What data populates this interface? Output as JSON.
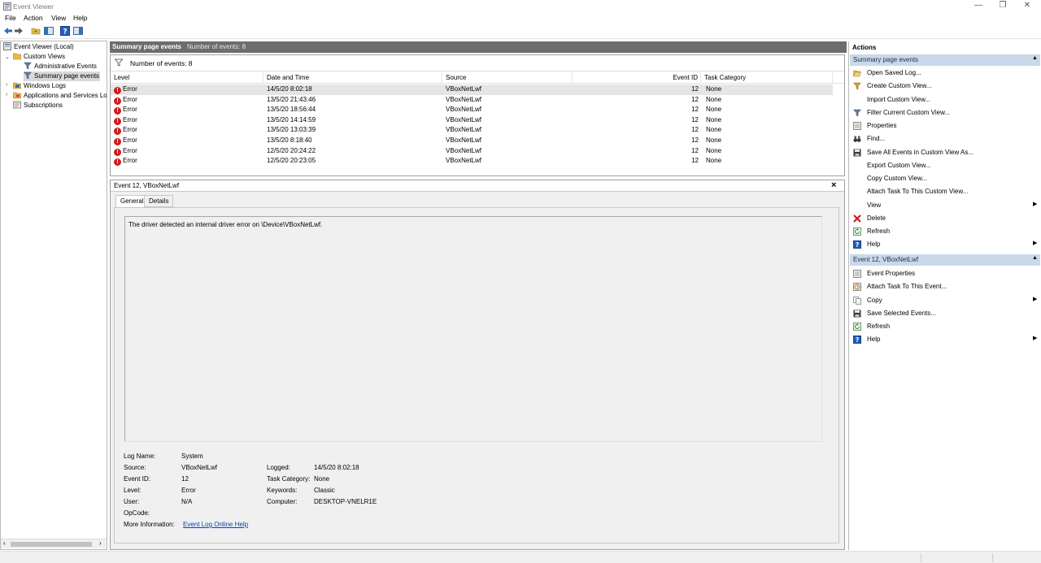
{
  "window": {
    "title": "Event Viewer"
  },
  "menu": [
    "File",
    "Action",
    "View",
    "Help"
  ],
  "tree": {
    "root": "Event Viewer (Local)",
    "custom_views": "Custom Views",
    "administrative_events": "Administrative Events",
    "summary_page_events": "Summary page events",
    "windows_logs": "Windows Logs",
    "apps_services": "Applications and Services Lo",
    "subscriptions": "Subscriptions"
  },
  "center": {
    "header_title": "Summary page events",
    "header_count": "Number of events: 8",
    "filter_text": "Number of events: 8",
    "columns": [
      "Level",
      "Date and Time",
      "Source",
      "Event ID",
      "Task Category"
    ],
    "rows": [
      {
        "level": "Error",
        "datetime": "14/5/20 8:02:18",
        "source": "VBoxNetLwf",
        "event_id": "12",
        "category": "None"
      },
      {
        "level": "Error",
        "datetime": "13/5/20 21:43:46",
        "source": "VBoxNetLwf",
        "event_id": "12",
        "category": "None"
      },
      {
        "level": "Error",
        "datetime": "13/5/20 18:56:44",
        "source": "VBoxNetLwf",
        "event_id": "12",
        "category": "None"
      },
      {
        "level": "Error",
        "datetime": "13/5/20 14:14:59",
        "source": "VBoxNetLwf",
        "event_id": "12",
        "category": "None"
      },
      {
        "level": "Error",
        "datetime": "13/5/20 13:03:39",
        "source": "VBoxNetLwf",
        "event_id": "12",
        "category": "None"
      },
      {
        "level": "Error",
        "datetime": "13/5/20 8:18:40",
        "source": "VBoxNetLwf",
        "event_id": "12",
        "category": "None"
      },
      {
        "level": "Error",
        "datetime": "12/5/20 20:24:22",
        "source": "VBoxNetLwf",
        "event_id": "12",
        "category": "None"
      },
      {
        "level": "Error",
        "datetime": "12/5/20 20:23:05",
        "source": "VBoxNetLwf",
        "event_id": "12",
        "category": "None"
      }
    ]
  },
  "detail": {
    "title": "Event 12, VBoxNetLwf",
    "tabs": [
      "General",
      "Details"
    ],
    "description": "The driver detected an internal driver error on \\Device\\VBoxNetLwf.",
    "labels": {
      "log_name": "Log Name:",
      "source": "Source:",
      "event_id": "Event ID:",
      "level": "Level:",
      "user": "User:",
      "opcode": "OpCode:",
      "more_info": "More Information:",
      "logged": "Logged:",
      "task_category": "Task Category:",
      "keywords": "Keywords:",
      "computer": "Computer:"
    },
    "values": {
      "log_name": "System",
      "source": "VBoxNetLwf",
      "event_id": "12",
      "level": "Error",
      "user": "N/A",
      "opcode": "",
      "more_info": "Event Log Online Help",
      "logged": "14/5/20 8:02:18",
      "task_category": "None",
      "keywords": "Classic",
      "computer": "DESKTOP-VNELR1E"
    }
  },
  "actions": {
    "title": "Actions",
    "section1": "Summary page events",
    "items1": [
      {
        "label": "Open Saved Log...",
        "icon": "folder-open-icon"
      },
      {
        "label": "Create Custom View...",
        "icon": "filter-create-icon"
      },
      {
        "label": "Import Custom View...",
        "icon": ""
      },
      {
        "label": "Filter Current Custom View...",
        "icon": "filter-icon"
      },
      {
        "label": "Properties",
        "icon": "properties-icon"
      },
      {
        "label": "Find...",
        "icon": "binoculars-icon"
      },
      {
        "label": "Save All Events in Custom View As...",
        "icon": "save-icon"
      },
      {
        "label": "Export Custom View...",
        "icon": ""
      },
      {
        "label": "Copy Custom View...",
        "icon": ""
      },
      {
        "label": "Attach Task To This Custom View...",
        "icon": ""
      },
      {
        "label": "View",
        "icon": "",
        "submenu": true
      },
      {
        "label": "Delete",
        "icon": "delete-icon"
      },
      {
        "label": "Refresh",
        "icon": "refresh-icon"
      },
      {
        "label": "Help",
        "icon": "help-icon",
        "submenu": true
      }
    ],
    "section2": "Event 12, VBoxNetLwf",
    "items2": [
      {
        "label": "Event Properties",
        "icon": "properties-icon"
      },
      {
        "label": "Attach Task To This Event...",
        "icon": "task-icon"
      },
      {
        "label": "Copy",
        "icon": "copy-icon",
        "submenu": true
      },
      {
        "label": "Save Selected Events...",
        "icon": "save-icon"
      },
      {
        "label": "Refresh",
        "icon": "refresh-icon"
      },
      {
        "label": "Help",
        "icon": "help-icon",
        "submenu": true
      }
    ]
  }
}
